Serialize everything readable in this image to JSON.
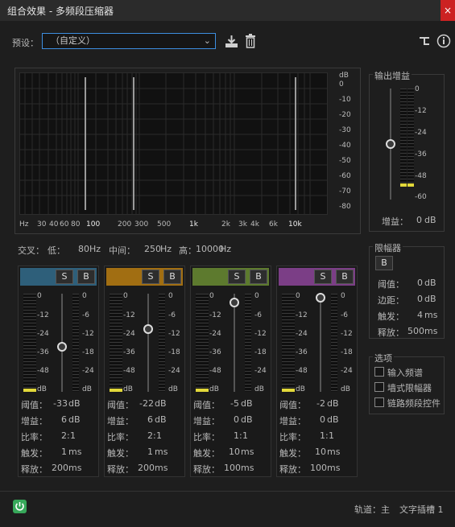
{
  "window": {
    "title": "组合效果 - 多频段压缩器",
    "close": "×"
  },
  "preset": {
    "label": "预设：",
    "value": "（自定义）"
  },
  "graph": {
    "db_unit": "dB",
    "db_ticks": [
      "0",
      "-10",
      "-20",
      "-30",
      "-40",
      "-50",
      "-60",
      "-70",
      "-80"
    ],
    "freq_ticks": [
      "Hz",
      "30",
      "40",
      "60",
      "80",
      "100",
      "200",
      "300",
      "500",
      "1k",
      "2k",
      "3k",
      "4k",
      "6k",
      "10k"
    ]
  },
  "output_gain": {
    "title": "输出增益",
    "ticks": [
      "0",
      "-12",
      "-24",
      "-36",
      "-48",
      "-60"
    ],
    "label": "增益：",
    "value": "0",
    "unit": "dB"
  },
  "crossover": {
    "label": "交叉：",
    "low_label": "低：",
    "low_value": "80",
    "mid_label": "中间：",
    "mid_value": "250",
    "high_label": "高：",
    "high_value": "10000",
    "unit": "Hz"
  },
  "bands": [
    {
      "color": "#2e5f7a",
      "threshold": "-33",
      "gain": "6",
      "ratio_a": "2",
      "ratio_b": "1",
      "attack": "1",
      "release": "200"
    },
    {
      "color": "#a16e12",
      "threshold": "-22",
      "gain": "6",
      "ratio_a": "2",
      "ratio_b": "1",
      "attack": "1",
      "release": "200"
    },
    {
      "color": "#5d7a2e",
      "threshold": "-5",
      "gain": "0",
      "ratio_a": "1",
      "ratio_b": "1",
      "attack": "10",
      "release": "100"
    },
    {
      "color": "#7b3e86",
      "threshold": "-2",
      "gain": "0",
      "ratio_a": "1",
      "ratio_b": "1",
      "attack": "10",
      "release": "100"
    }
  ],
  "band_labels": {
    "solo": "S",
    "bypass": "B",
    "threshold": "阈值：",
    "gain": "增益：",
    "ratio": "比率：",
    "attack": "触发：",
    "release": "释放：",
    "db": "dB",
    "ms": "ms",
    "colon": ":"
  },
  "band_meter_left_ticks": [
    "0",
    "-12",
    "-24",
    "-36",
    "-48",
    "dB"
  ],
  "band_meter_right_ticks": [
    "0",
    "-6",
    "-12",
    "-18",
    "-24",
    "dB"
  ],
  "limiter": {
    "title": "限幅器",
    "bypass": "B",
    "threshold_label": "阈值：",
    "threshold": "0",
    "margin_label": "边距：",
    "margin": "0",
    "attack_label": "触发：",
    "attack": "4",
    "release_label": "释放：",
    "release": "500",
    "db": "dB",
    "ms": "ms"
  },
  "options": {
    "title": "选项",
    "items": [
      "输入频谱",
      "墙式限幅器",
      "链路频段控件"
    ]
  },
  "footer": {
    "track": "轨道：主",
    "slot": "文字插槽 1"
  }
}
